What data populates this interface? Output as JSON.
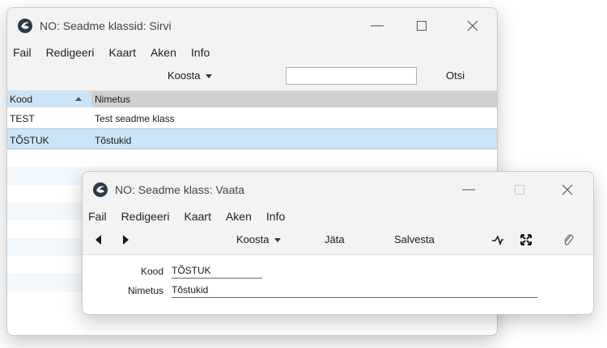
{
  "list_window": {
    "title": "NO: Seadme klassid: Sirvi",
    "menu": [
      "Fail",
      "Redigeeri",
      "Kaart",
      "Aken",
      "Info"
    ],
    "toolbar": {
      "create_label": "Koosta",
      "search_value": "",
      "search_label": "Otsi"
    },
    "columns": [
      "Kood",
      "Nimetus"
    ],
    "rows": [
      {
        "kood": "TEST",
        "nimetus": "Test seadme klass"
      },
      {
        "kood": "TÕSTUK",
        "nimetus": "Tõstukid"
      }
    ]
  },
  "record_window": {
    "title": "NO: Seadme klass: Vaata",
    "menu": [
      "Fail",
      "Redigeeri",
      "Kaart",
      "Aken",
      "Info"
    ],
    "toolbar": {
      "create_label": "Koosta",
      "discard_label": "Jäta",
      "save_label": "Salvesta"
    },
    "fields": {
      "kood_label": "Kood",
      "kood_value": "TÕSTUK",
      "nimetus_label": "Nimetus",
      "nimetus_value": "Tõstukid"
    }
  },
  "colors": {
    "selection": "#cce4f7",
    "header_gray": "#cfcfcf",
    "chrome": "#f3f3f3"
  }
}
